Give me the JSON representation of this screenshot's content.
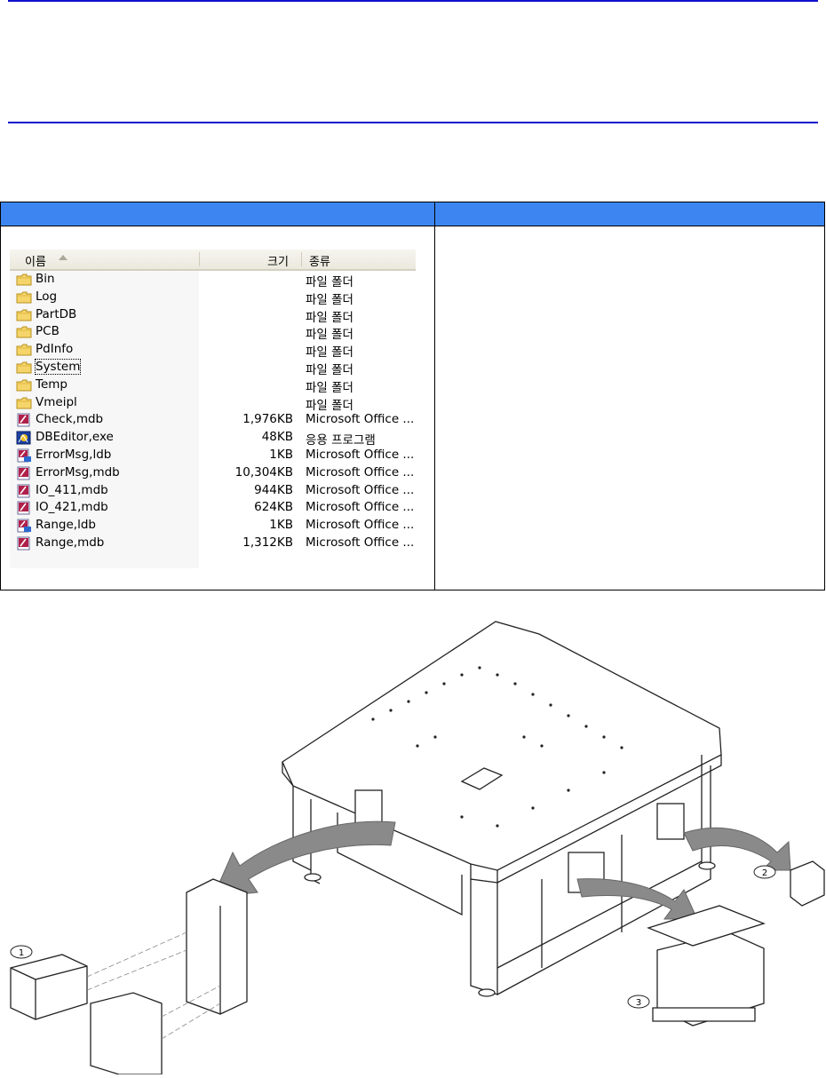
{
  "explorer": {
    "columns": {
      "name": "이름",
      "size": "크기",
      "type": "종류"
    },
    "files": [
      {
        "name": "Bin",
        "size": "",
        "type": "파일 폴더",
        "icon": "folder-icon"
      },
      {
        "name": "Log",
        "size": "",
        "type": "파일 폴더",
        "icon": "folder-icon"
      },
      {
        "name": "PartDB",
        "size": "",
        "type": "파일 폴더",
        "icon": "folder-icon"
      },
      {
        "name": "PCB",
        "size": "",
        "type": "파일 폴더",
        "icon": "folder-icon"
      },
      {
        "name": "PdInfo",
        "size": "",
        "type": "파일 폴더",
        "icon": "folder-icon"
      },
      {
        "name": "System",
        "size": "",
        "type": "파일 폴더",
        "icon": "folder-icon"
      },
      {
        "name": "Temp",
        "size": "",
        "type": "파일 폴더",
        "icon": "folder-icon"
      },
      {
        "name": "Vmeipl",
        "size": "",
        "type": "파일 폴더",
        "icon": "folder-icon"
      },
      {
        "name": "Check,mdb",
        "size": "1,976KB",
        "type": "Microsoft Office ...",
        "icon": "access-database-icon"
      },
      {
        "name": "DBEditor,exe",
        "size": "48KB",
        "type": "응용 프로그램",
        "icon": "application-icon"
      },
      {
        "name": "ErrorMsg,ldb",
        "size": "1KB",
        "type": "Microsoft Office ...",
        "icon": "access-lock-file-icon"
      },
      {
        "name": "ErrorMsg,mdb",
        "size": "10,304KB",
        "type": "Microsoft Office ...",
        "icon": "access-database-icon"
      },
      {
        "name": "IO_411,mdb",
        "size": "944KB",
        "type": "Microsoft Office ...",
        "icon": "access-database-icon"
      },
      {
        "name": "IO_421,mdb",
        "size": "624KB",
        "type": "Microsoft Office ...",
        "icon": "access-database-icon"
      },
      {
        "name": "Range,ldb",
        "size": "1KB",
        "type": "Microsoft Office ...",
        "icon": "access-lock-file-icon"
      },
      {
        "name": "Range,mdb",
        "size": "1,312KB",
        "type": "Microsoft Office ...",
        "icon": "access-database-icon"
      }
    ],
    "focused_item": "System"
  },
  "illustration": {
    "callouts": [
      "1",
      "2",
      "3"
    ]
  },
  "colors": {
    "rule": "#1010cc",
    "table_header": "#3d86f2",
    "folder": "#f5d56a"
  }
}
